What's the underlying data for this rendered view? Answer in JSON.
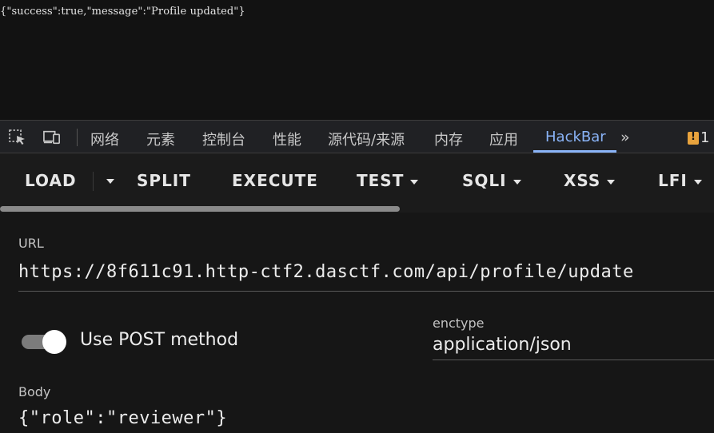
{
  "response": {
    "text": "{\"success\":true,\"message\":\"Profile updated\"}"
  },
  "devtools": {
    "icons": [
      "inspect-element-icon",
      "device-toolbar-icon"
    ],
    "tabs": [
      {
        "label": "网络",
        "active": false
      },
      {
        "label": "元素",
        "active": false
      },
      {
        "label": "控制台",
        "active": false
      },
      {
        "label": "性能",
        "active": false
      },
      {
        "label": "源代码/来源",
        "active": false
      },
      {
        "label": "内存",
        "active": false
      },
      {
        "label": "应用",
        "active": false
      },
      {
        "label": "HackBar",
        "active": true
      }
    ],
    "more_label": "»",
    "issues_count": "1",
    "accent": "#8ab4f8"
  },
  "hackbar": {
    "buttons": {
      "load": "LOAD",
      "split": "SPLIT",
      "execute": "EXECUTE",
      "test": "TEST",
      "sqli": "SQLI",
      "xss": "XSS",
      "lfi": "LFI"
    },
    "url_label": "URL",
    "url_value": "https://8f611c91.http-ctf2.dasctf.com/api/profile/update",
    "post_toggle_label": "Use POST method",
    "post_enabled": true,
    "enctype_label": "enctype",
    "enctype_value": "application/json",
    "body_label": "Body",
    "body_value": "{\"role\":\"reviewer\"}"
  }
}
